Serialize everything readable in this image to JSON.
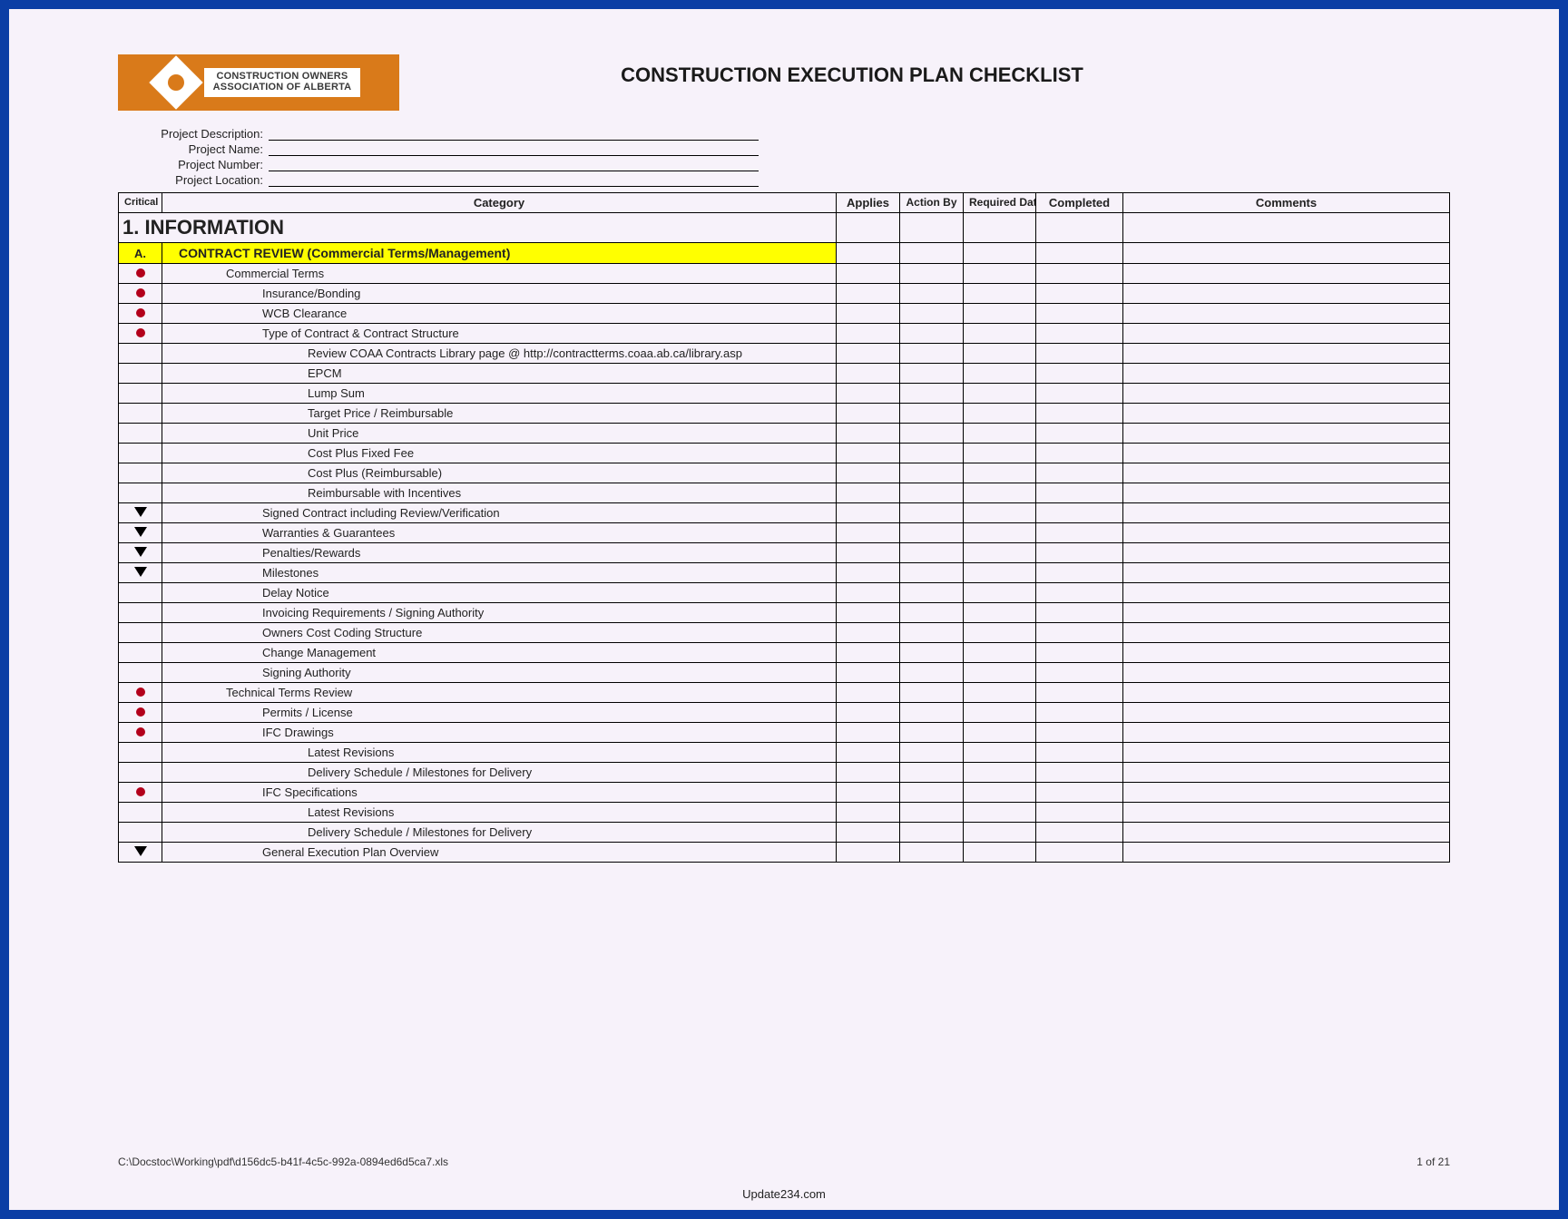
{
  "logo": {
    "line1": "CONSTRUCTION OWNERS",
    "line2": "ASSOCIATION OF ALBERTA"
  },
  "title": "CONSTRUCTION EXECUTION PLAN CHECKLIST",
  "meta_labels": {
    "description": "Project Description:",
    "name": "Project Name:",
    "number": "Project Number:",
    "location": "Project Location:"
  },
  "columns": {
    "critical": "Critical Level",
    "category": "Category",
    "applies": "Applies",
    "action_by": "Action By",
    "required_date": "Required Date",
    "completed": "Completed",
    "comments": "Comments"
  },
  "section": {
    "number_title": "1. INFORMATION",
    "sub_letter": "A.",
    "sub_title": "CONTRACT REVIEW (Commercial Terms/Management)"
  },
  "rows": [
    {
      "crit": "dot",
      "indent": 1,
      "label": "Commercial Terms"
    },
    {
      "crit": "dot",
      "indent": 2,
      "label": "Insurance/Bonding"
    },
    {
      "crit": "dot",
      "indent": 2,
      "label": "WCB Clearance"
    },
    {
      "crit": "dot",
      "indent": 2,
      "label": "Type of Contract & Contract Structure"
    },
    {
      "crit": "",
      "indent": 3,
      "label": "Review COAA Contracts Library page @ http://contractterms.coaa.ab.ca/library.asp"
    },
    {
      "crit": "",
      "indent": 3,
      "label": "EPCM"
    },
    {
      "crit": "",
      "indent": 3,
      "label": "Lump Sum"
    },
    {
      "crit": "",
      "indent": 3,
      "label": "Target Price / Reimbursable"
    },
    {
      "crit": "",
      "indent": 3,
      "label": "Unit Price"
    },
    {
      "crit": "",
      "indent": 3,
      "label": "Cost Plus Fixed Fee"
    },
    {
      "crit": "",
      "indent": 3,
      "label": "Cost Plus (Reimbursable)"
    },
    {
      "crit": "",
      "indent": 3,
      "label": "Reimbursable with Incentives"
    },
    {
      "crit": "tri",
      "indent": 2,
      "label": "Signed Contract including Review/Verification"
    },
    {
      "crit": "tri",
      "indent": 2,
      "label": "Warranties & Guarantees"
    },
    {
      "crit": "tri",
      "indent": 2,
      "label": "Penalties/Rewards"
    },
    {
      "crit": "tri",
      "indent": 2,
      "label": "Milestones"
    },
    {
      "crit": "",
      "indent": 2,
      "label": "Delay Notice"
    },
    {
      "crit": "",
      "indent": 2,
      "label": "Invoicing Requirements / Signing Authority"
    },
    {
      "crit": "",
      "indent": 2,
      "label": "Owners Cost Coding Structure"
    },
    {
      "crit": "",
      "indent": 2,
      "label": "Change Management"
    },
    {
      "crit": "",
      "indent": 2,
      "label": "Signing Authority"
    },
    {
      "crit": "dot",
      "indent": 1,
      "label": "Technical Terms Review"
    },
    {
      "crit": "dot",
      "indent": 2,
      "label": "Permits / License"
    },
    {
      "crit": "dot",
      "indent": 2,
      "label": "IFC Drawings"
    },
    {
      "crit": "",
      "indent": 3,
      "label": "Latest Revisions"
    },
    {
      "crit": "",
      "indent": 3,
      "label": "Delivery Schedule / Milestones for Delivery"
    },
    {
      "crit": "dot",
      "indent": 2,
      "label": "IFC Specifications"
    },
    {
      "crit": "",
      "indent": 3,
      "label": "Latest Revisions"
    },
    {
      "crit": "",
      "indent": 3,
      "label": "Delivery Schedule / Milestones for Delivery"
    },
    {
      "crit": "tri",
      "indent": 2,
      "label": "General Execution Plan Overview"
    }
  ],
  "footer": {
    "path": "C:\\Docstoc\\Working\\pdf\\d156dc5-b41f-4c5c-992a-0894ed6d5ca7.xls",
    "page": "1 of 21"
  },
  "source": "Update234.com"
}
